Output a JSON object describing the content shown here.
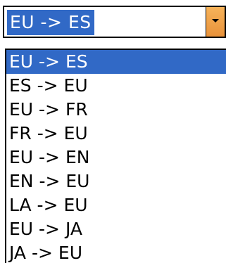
{
  "combo": {
    "selected_value": "EU -> ES"
  },
  "dropdown": {
    "items": [
      {
        "label": "EU -> ES",
        "selected": true
      },
      {
        "label": "ES -> EU",
        "selected": false
      },
      {
        "label": "EU -> FR",
        "selected": false
      },
      {
        "label": "FR -> EU",
        "selected": false
      },
      {
        "label": "EU -> EN",
        "selected": false
      },
      {
        "label": "EN -> EU",
        "selected": false
      },
      {
        "label": "LA -> EU",
        "selected": false
      },
      {
        "label": "EU -> JA",
        "selected": false
      },
      {
        "label": "JA -> EU",
        "selected": false
      }
    ]
  },
  "colors": {
    "selection": "#3169c6",
    "button": "#f0a04b"
  }
}
